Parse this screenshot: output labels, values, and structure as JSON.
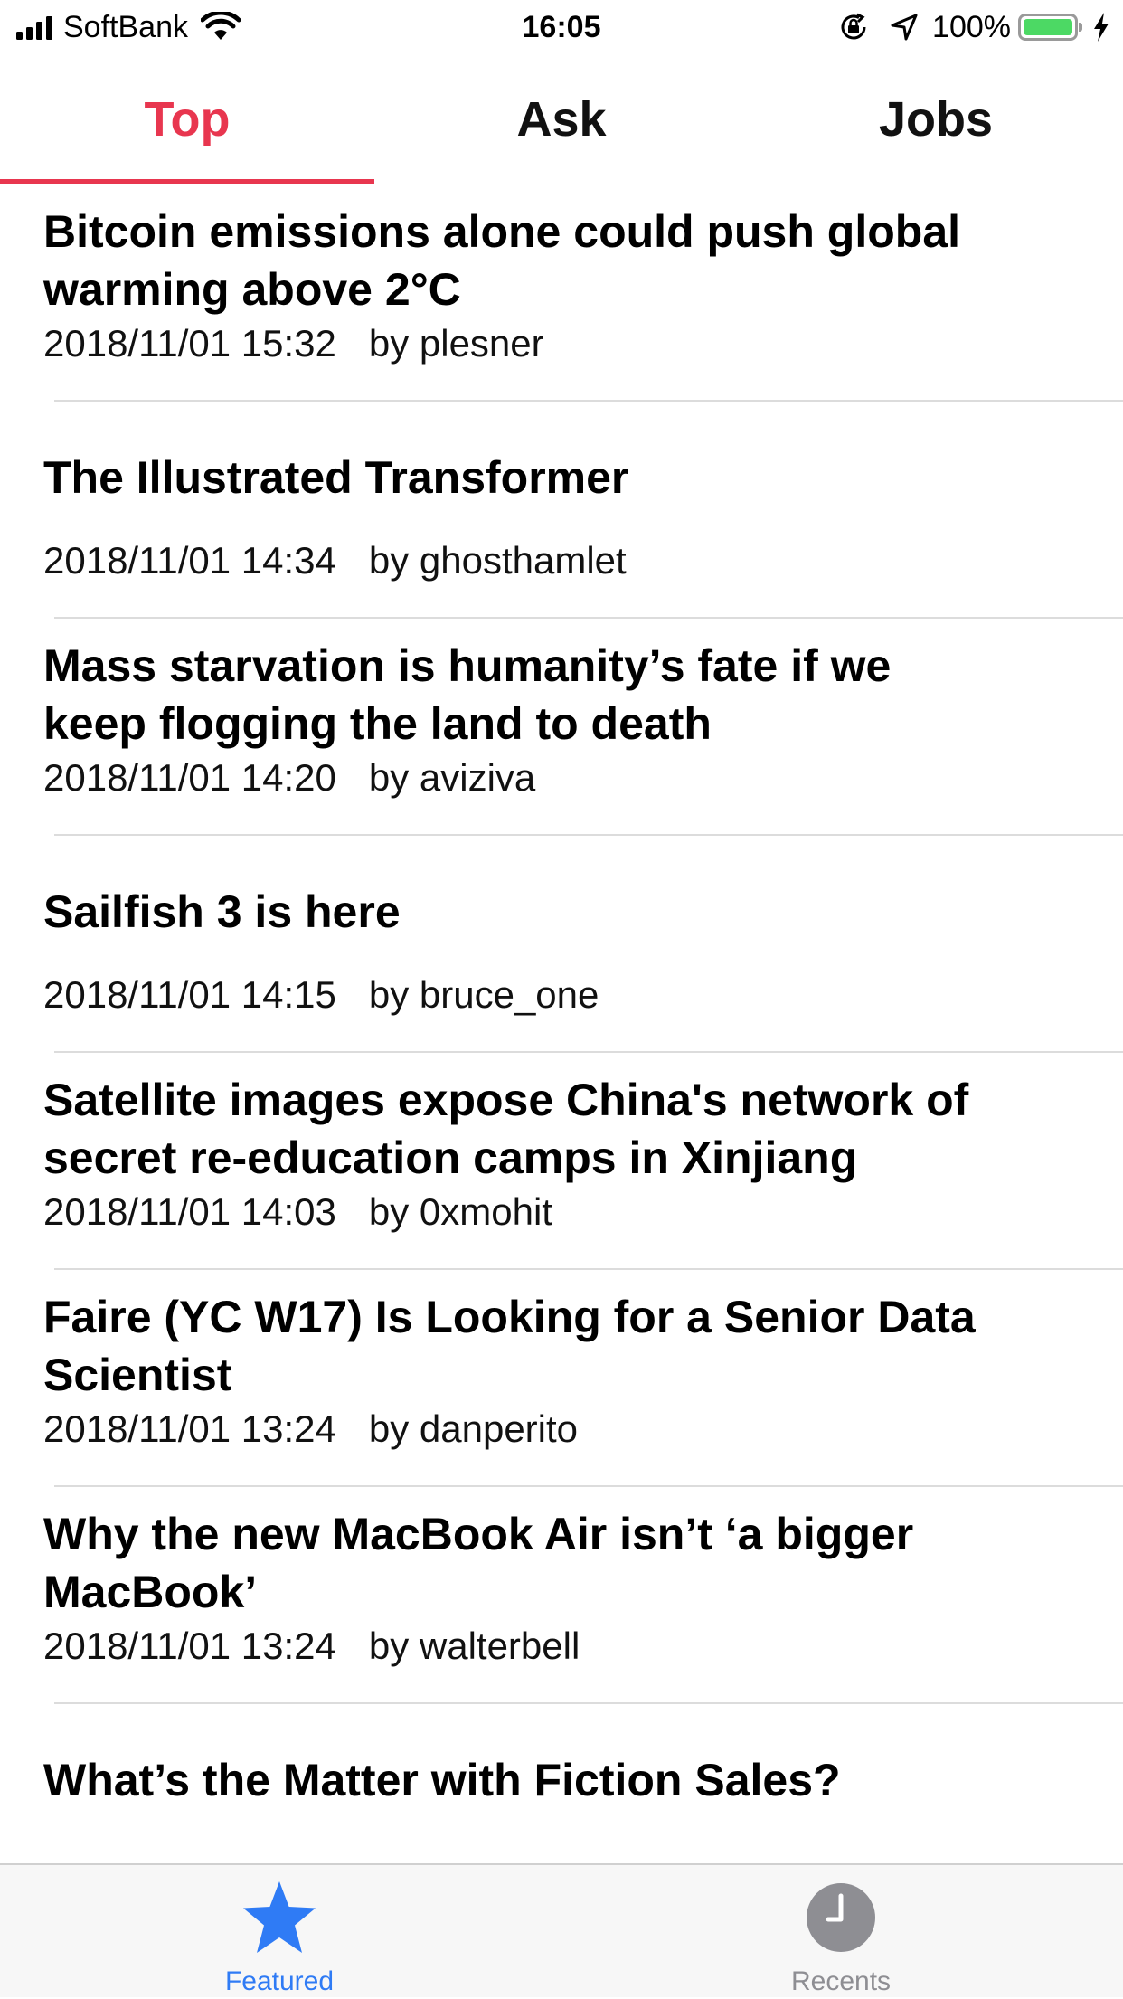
{
  "status_bar": {
    "carrier": "SoftBank",
    "time": "16:05",
    "battery_percent": "100%",
    "battery_level": 1.0,
    "battery_color": "#4cd964"
  },
  "tabs": [
    {
      "label": "Top",
      "active": true
    },
    {
      "label": "Ask",
      "active": false
    },
    {
      "label": "Jobs",
      "active": false
    }
  ],
  "accent_color": "#e8364f",
  "stories": [
    {
      "title": "Bitcoin emissions alone could push global warming above 2°C",
      "date": "2018/11/01 15:32",
      "author": "by plesner"
    },
    {
      "title": "The Illustrated Transformer",
      "date": "2018/11/01 14:34",
      "author": "by ghosthamlet"
    },
    {
      "title": "Mass starvation is humanity’s fate if we keep flogging the land to death",
      "date": "2018/11/01 14:20",
      "author": "by aviziva"
    },
    {
      "title": "Sailfish 3 is here",
      "date": "2018/11/01 14:15",
      "author": "by bruce_one"
    },
    {
      "title": "Satellite images expose China's network of secret re-education camps in Xinjiang",
      "date": "2018/11/01 14:03",
      "author": "by 0xmohit"
    },
    {
      "title": "Faire (YC W17) Is Looking for a Senior Data Scientist",
      "date": "2018/11/01 13:24",
      "author": "by danperito"
    },
    {
      "title": "Why the new MacBook Air isn’t ‘a bigger MacBook’",
      "date": "2018/11/01 13:24",
      "author": "by walterbell"
    },
    {
      "title": "What’s the Matter with Fiction Sales?",
      "date": "",
      "author": ""
    }
  ],
  "tab_bar": {
    "featured_label": "Featured",
    "featured_icon": "star-icon",
    "recents_label": "Recents",
    "recents_icon": "clock-icon"
  }
}
